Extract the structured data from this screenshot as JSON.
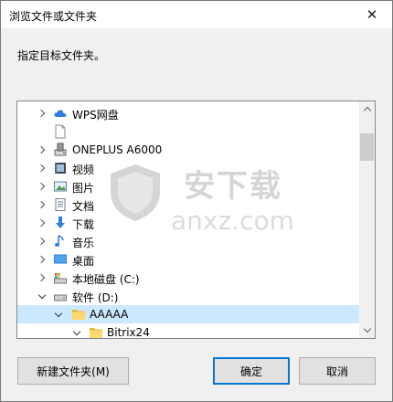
{
  "window": {
    "title": "浏览文件或文件夹",
    "close_glyph": "✕"
  },
  "instruction": "指定目标文件夹。",
  "tree": {
    "items": [
      {
        "label": "WPS网盘",
        "icon": "cloud-icon",
        "state": "collapsed"
      },
      {
        "label": "",
        "icon": "blank-file-icon",
        "state": "none"
      },
      {
        "label": "ONEPLUS A6000",
        "icon": "phone-device-icon",
        "state": "collapsed"
      },
      {
        "label": "视频",
        "icon": "video-folder-icon",
        "state": "collapsed"
      },
      {
        "label": "图片",
        "icon": "pictures-folder-icon",
        "state": "collapsed"
      },
      {
        "label": "文档",
        "icon": "documents-folder-icon",
        "state": "collapsed"
      },
      {
        "label": "下载",
        "icon": "downloads-folder-icon",
        "state": "collapsed"
      },
      {
        "label": "音乐",
        "icon": "music-folder-icon",
        "state": "collapsed"
      },
      {
        "label": "桌面",
        "icon": "desktop-folder-icon",
        "state": "collapsed"
      },
      {
        "label": "本地磁盘 (C:)",
        "icon": "system-drive-icon",
        "state": "collapsed"
      },
      {
        "label": "软件 (D:)",
        "icon": "drive-icon",
        "state": "expanded"
      },
      {
        "label": "AAAAA",
        "icon": "folder-icon",
        "state": "expanded",
        "selected": true
      },
      {
        "label": "Bitrix24",
        "icon": "folder-icon",
        "state": "expanded"
      }
    ]
  },
  "buttons": {
    "new_folder": "新建文件夹(M)",
    "ok": "确定",
    "cancel": "取消"
  },
  "watermark": {
    "text": "安下载",
    "url": "anxz.com"
  },
  "colors": {
    "selection": "#cce8ff",
    "default_button_border": "#0078d7",
    "folder": "#ffd86b"
  }
}
